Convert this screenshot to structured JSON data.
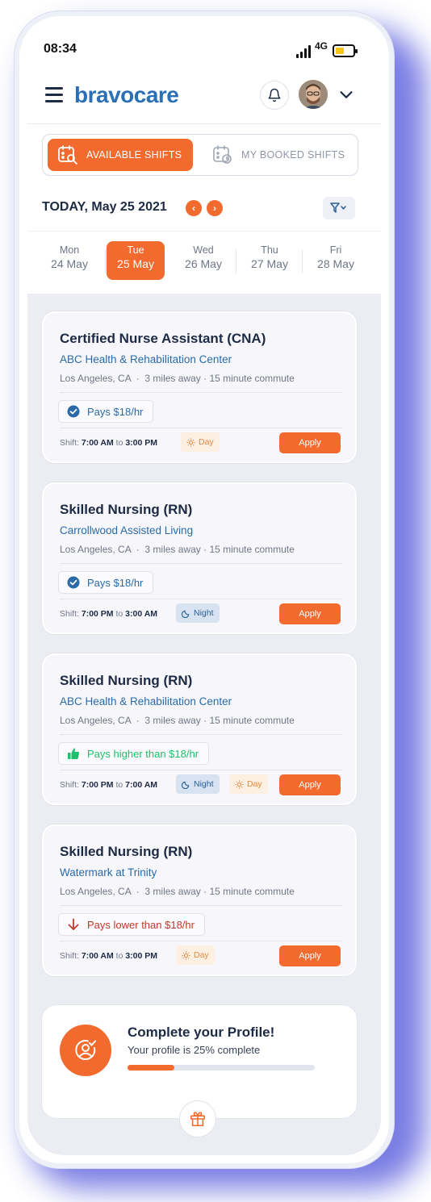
{
  "status_bar": {
    "time": "08:34",
    "network": "4G"
  },
  "header": {
    "logo": "bravocare"
  },
  "tabs": [
    {
      "label": "AVAILABLE SHIFTS",
      "active": true
    },
    {
      "label": "MY BOOKED SHIFTS",
      "active": false
    }
  ],
  "date_nav": {
    "title": "TODAY, May 25 2021",
    "prev": "‹",
    "next": "›"
  },
  "days": [
    {
      "name": "Mon",
      "date": "24 May"
    },
    {
      "name": "Tue",
      "date": "25 May",
      "selected": true
    },
    {
      "name": "Wed",
      "date": "26 May"
    },
    {
      "name": "Thu",
      "date": "27 May"
    },
    {
      "name": "Fri",
      "date": "28 May"
    }
  ],
  "shifts": [
    {
      "title": "Certified Nurse Assistant (CNA)",
      "facility": "ABC Health & Rehabilitation Center",
      "location": "Los Angeles, CA",
      "distance": "3 miles away",
      "commute": "15 minute commute",
      "pay": "Pays $18/hr",
      "pay_type": "standard",
      "shift_label": "Shift:",
      "start": "7:00 AM",
      "to": "to",
      "end": "3:00 PM",
      "badges": [
        "Day"
      ],
      "apply": "Apply"
    },
    {
      "title": "Skilled Nursing (RN)",
      "facility": "Carrollwood Assisted Living",
      "location": "Los Angeles, CA",
      "distance": "3 miles away",
      "commute": "15 minute commute",
      "pay": "Pays $18/hr",
      "pay_type": "standard",
      "shift_label": "Shift:",
      "start": "7:00 PM",
      "to": "to",
      "end": "3:00 AM",
      "badges": [
        "Night"
      ],
      "apply": "Apply"
    },
    {
      "title": "Skilled Nursing (RN)",
      "facility": "ABC Health & Rehabilitation Center",
      "location": "Los Angeles, CA",
      "distance": "3 miles away",
      "commute": "15 minute commute",
      "pay": "Pays higher than $18/hr",
      "pay_type": "higher",
      "shift_label": "Shift:",
      "start": "7:00 PM",
      "to": "to",
      "end": "7:00 AM",
      "badges": [
        "Night",
        "Day"
      ],
      "apply": "Apply"
    },
    {
      "title": "Skilled Nursing (RN)",
      "facility": "Watermark at Trinity",
      "location": "Los Angeles, CA",
      "distance": "3 miles away",
      "commute": "15 minute commute",
      "pay": "Pays lower than $18/hr",
      "pay_type": "lower",
      "shift_label": "Shift:",
      "start": "7:00 AM",
      "to": "to",
      "end": "3:00 PM",
      "badges": [
        "Day"
      ],
      "apply": "Apply"
    }
  ],
  "profile": {
    "title": "Complete your Profile!",
    "subtitle": "Your profile is 25% complete",
    "progress": 0.25
  },
  "colors": {
    "accent": "#f26a2e",
    "brand": "#2b6fb5",
    "pay_standard": "#2a6aa8",
    "pay_higher": "#1fbf6b",
    "pay_lower": "#c0392b"
  }
}
